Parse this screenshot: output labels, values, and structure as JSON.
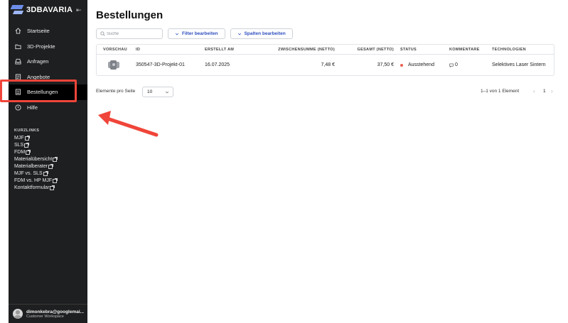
{
  "brand": {
    "name": "3DBAVARIA",
    "collapse_icon": "collapse-sidebar-icon"
  },
  "sidebar": {
    "items": [
      {
        "label": "Startseite",
        "icon": "home-icon"
      },
      {
        "label": "3D-Projekte",
        "icon": "folder-icon"
      },
      {
        "label": "Anfragen",
        "icon": "inbox-icon"
      },
      {
        "label": "Angebote",
        "icon": "document-icon"
      },
      {
        "label": "Bestellungen",
        "icon": "order-icon",
        "active": true
      },
      {
        "label": "Hilfe",
        "icon": "help-icon"
      }
    ],
    "quicklinks_title": "KURZLINKS",
    "quicklinks": [
      "MJF",
      "SLS",
      "FDM",
      "Materialübersicht",
      "Materialberater",
      "MJF vs. SLS",
      "FDM vs. HP MJF",
      "Kontaktformular"
    ],
    "user": {
      "email": "dimonkebra@googlemai...",
      "workspace": "Customer Workspace"
    }
  },
  "main": {
    "title": "Bestellungen",
    "search": {
      "placeholder": "Suche",
      "value": ""
    },
    "filter_label": "Filter bearbeiten",
    "columns_label": "Spalten bearbeiten",
    "table": {
      "headers": [
        "VORSCHAU",
        "ID",
        "ERSTELLT AM",
        "ZWISCHENSUMME (NETTO)",
        "GESAMT (NETTO)",
        "STATUS",
        "KOMMENTARE",
        "TECHNOLOGIEN"
      ],
      "rows": [
        {
          "id": "350547-3D-Projekt-01",
          "created": "16.07.2025",
          "subtotal": "7,48 €",
          "total": "37,50 €",
          "status": "Ausstehend",
          "comments": "0",
          "technology": "Selektives Laser Sintern"
        }
      ]
    },
    "pagination": {
      "per_page_label": "Elemente pro Seite",
      "per_page_value": "10",
      "range": "1–1 von 1 Element",
      "page": "1"
    }
  },
  "colors": {
    "sidebar_bg": "#1e1f21",
    "accent": "#2f4fbf",
    "status_pending": "#e8604f",
    "highlight": "#f0453a"
  }
}
